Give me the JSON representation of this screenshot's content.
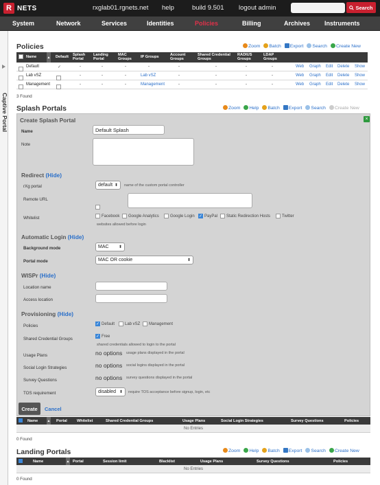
{
  "topbar": {
    "brand": "NETS",
    "brand_letter": "R",
    "host": "rxglab01.rgnets.net",
    "help": "help",
    "build": "build 9.501",
    "logout": "logout admin",
    "search_placeholder": "",
    "search_button": "Search"
  },
  "menu": [
    "System",
    "Network",
    "Services",
    "Identities",
    "Policies",
    "Billing",
    "Archives",
    "Instruments"
  ],
  "sidetab": "Captive Portal",
  "actions": {
    "zoom": "Zoom",
    "help": "Help",
    "batch": "Batch",
    "export": "Export",
    "search": "Search",
    "create": "Create New"
  },
  "policies": {
    "title": "Policies",
    "headers": [
      "Name",
      "Default",
      "Splash Portal",
      "Landing Portal",
      "MAC Groups",
      "IP Groups",
      "Account Groups",
      "Shared Credential Groups",
      "RADIUS Groups",
      "LDAP Groups"
    ],
    "rows": [
      {
        "name": "Default",
        "default": true,
        "splash": "-",
        "landing": "-",
        "mac": "-",
        "ip": "-",
        "account": "-",
        "shared": "-",
        "radius": "-",
        "ldap": "-"
      },
      {
        "name": "Lab vSZ",
        "default": false,
        "splash": "-",
        "landing": "-",
        "mac": "-",
        "ip": "Lab vSZ",
        "account": "-",
        "shared": "-",
        "radius": "-",
        "ldap": "-"
      },
      {
        "name": "Management",
        "default": false,
        "splash": "-",
        "landing": "-",
        "mac": "-",
        "ip": "Management",
        "account": "-",
        "shared": "-",
        "radius": "-",
        "ldap": "-"
      }
    ],
    "row_links": [
      "Web",
      "Graph",
      "Edit",
      "Delete",
      "Show"
    ],
    "found": "3 Found"
  },
  "splash": {
    "title": "Splash Portals",
    "form_title": "Create Splash Portal",
    "name_label": "Name",
    "name_value": "Default Splash",
    "note_label": "Note",
    "redirect": "Redirect",
    "hide": "(Hide)",
    "rxg_portal_label": "rXg portal",
    "rxg_portal_value": "default",
    "rxg_portal_help": "name of the custom portal controller",
    "remote_url_label": "Remote URL",
    "whitelist_label": "Whitelist",
    "whitelist_opts": [
      {
        "l": "Facebook",
        "on": false
      },
      {
        "l": "Google Analytics",
        "on": false
      },
      {
        "l": "Google Login",
        "on": false
      },
      {
        "l": "PayPal",
        "on": true
      },
      {
        "l": "Static Redirection Hosts",
        "on": false
      },
      {
        "l": "Twitter",
        "on": false
      }
    ],
    "whitelist_help": "websites allowed before login",
    "auto_login": "Automatic Login",
    "bg_mode_label": "Background mode",
    "bg_mode_value": "MAC",
    "portal_mode_label": "Portal mode",
    "portal_mode_value": "MAC OR cookie",
    "wispr": "WISPr",
    "location_name_label": "Location name",
    "location_access_label": "Access location",
    "provisioning": "Provisioning",
    "policies_label": "Policies",
    "policies_opts": [
      {
        "l": "Default",
        "on": true
      },
      {
        "l": "Lab vSZ",
        "on": false
      },
      {
        "l": "Management",
        "on": false
      }
    ],
    "shared_label": "Shared Credential Groups",
    "shared_opt": "Free",
    "shared_help": "shared credentials allowed to login to the portal",
    "usage_label": "Usage Plans",
    "usage_value": "no options",
    "usage_help": "usage plans displayed in the portal",
    "social_label": "Social Login Strategies",
    "social_value": "no options",
    "social_help": "social logins displayed in the portal",
    "survey_label": "Survey Questions",
    "survey_value": "no options",
    "survey_help": "survey questions displayed in the portal",
    "tos_label": "TOS requirement",
    "tos_value": "disabled",
    "tos_help": "require TOS acceptance before signup, login, etc",
    "create": "Create",
    "cancel": "Cancel",
    "headers": [
      "Name",
      "Portal",
      "Whitelist",
      "Shared Credential Groups",
      "Usage Plans",
      "Social Login Strategies",
      "Survey Questions",
      "Policies"
    ],
    "empty": "No Entries",
    "found": "0 Found"
  },
  "landing": {
    "title": "Landing Portals",
    "headers": [
      "Name",
      "Portal",
      "Session limit",
      "Blacklist",
      "Usage Plans",
      "Survey Questions",
      "Policies"
    ],
    "empty": "No Entries",
    "found": "0 Found"
  },
  "colors": {
    "brand": "#c8202f",
    "link": "#2a6fc9",
    "active_menu": "#e0314a"
  }
}
